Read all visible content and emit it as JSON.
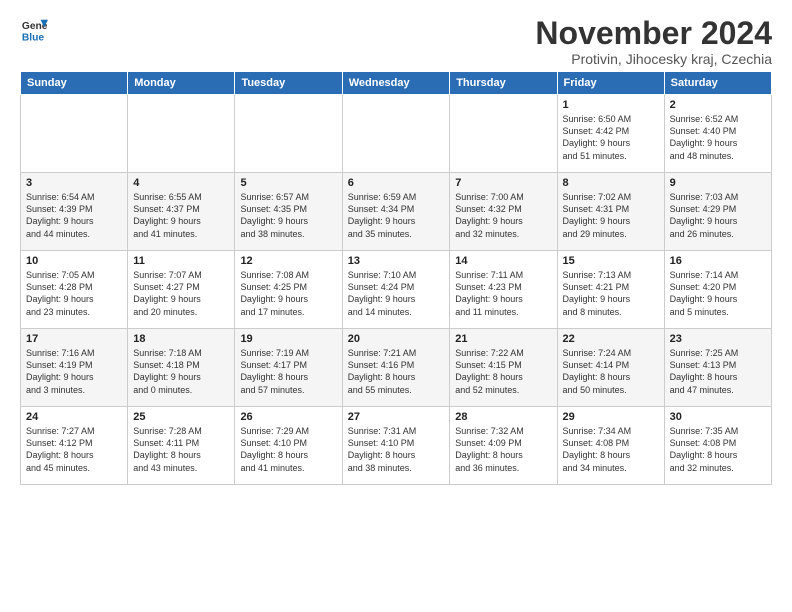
{
  "logo": {
    "general": "General",
    "blue": "Blue"
  },
  "title": "November 2024",
  "subtitle": "Protivin, Jihocesky kraj, Czechia",
  "days_of_week": [
    "Sunday",
    "Monday",
    "Tuesday",
    "Wednesday",
    "Thursday",
    "Friday",
    "Saturday"
  ],
  "weeks": [
    [
      {
        "day": "",
        "info": ""
      },
      {
        "day": "",
        "info": ""
      },
      {
        "day": "",
        "info": ""
      },
      {
        "day": "",
        "info": ""
      },
      {
        "day": "",
        "info": ""
      },
      {
        "day": "1",
        "info": "Sunrise: 6:50 AM\nSunset: 4:42 PM\nDaylight: 9 hours\nand 51 minutes."
      },
      {
        "day": "2",
        "info": "Sunrise: 6:52 AM\nSunset: 4:40 PM\nDaylight: 9 hours\nand 48 minutes."
      }
    ],
    [
      {
        "day": "3",
        "info": "Sunrise: 6:54 AM\nSunset: 4:39 PM\nDaylight: 9 hours\nand 44 minutes."
      },
      {
        "day": "4",
        "info": "Sunrise: 6:55 AM\nSunset: 4:37 PM\nDaylight: 9 hours\nand 41 minutes."
      },
      {
        "day": "5",
        "info": "Sunrise: 6:57 AM\nSunset: 4:35 PM\nDaylight: 9 hours\nand 38 minutes."
      },
      {
        "day": "6",
        "info": "Sunrise: 6:59 AM\nSunset: 4:34 PM\nDaylight: 9 hours\nand 35 minutes."
      },
      {
        "day": "7",
        "info": "Sunrise: 7:00 AM\nSunset: 4:32 PM\nDaylight: 9 hours\nand 32 minutes."
      },
      {
        "day": "8",
        "info": "Sunrise: 7:02 AM\nSunset: 4:31 PM\nDaylight: 9 hours\nand 29 minutes."
      },
      {
        "day": "9",
        "info": "Sunrise: 7:03 AM\nSunset: 4:29 PM\nDaylight: 9 hours\nand 26 minutes."
      }
    ],
    [
      {
        "day": "10",
        "info": "Sunrise: 7:05 AM\nSunset: 4:28 PM\nDaylight: 9 hours\nand 23 minutes."
      },
      {
        "day": "11",
        "info": "Sunrise: 7:07 AM\nSunset: 4:27 PM\nDaylight: 9 hours\nand 20 minutes."
      },
      {
        "day": "12",
        "info": "Sunrise: 7:08 AM\nSunset: 4:25 PM\nDaylight: 9 hours\nand 17 minutes."
      },
      {
        "day": "13",
        "info": "Sunrise: 7:10 AM\nSunset: 4:24 PM\nDaylight: 9 hours\nand 14 minutes."
      },
      {
        "day": "14",
        "info": "Sunrise: 7:11 AM\nSunset: 4:23 PM\nDaylight: 9 hours\nand 11 minutes."
      },
      {
        "day": "15",
        "info": "Sunrise: 7:13 AM\nSunset: 4:21 PM\nDaylight: 9 hours\nand 8 minutes."
      },
      {
        "day": "16",
        "info": "Sunrise: 7:14 AM\nSunset: 4:20 PM\nDaylight: 9 hours\nand 5 minutes."
      }
    ],
    [
      {
        "day": "17",
        "info": "Sunrise: 7:16 AM\nSunset: 4:19 PM\nDaylight: 9 hours\nand 3 minutes."
      },
      {
        "day": "18",
        "info": "Sunrise: 7:18 AM\nSunset: 4:18 PM\nDaylight: 9 hours\nand 0 minutes."
      },
      {
        "day": "19",
        "info": "Sunrise: 7:19 AM\nSunset: 4:17 PM\nDaylight: 8 hours\nand 57 minutes."
      },
      {
        "day": "20",
        "info": "Sunrise: 7:21 AM\nSunset: 4:16 PM\nDaylight: 8 hours\nand 55 minutes."
      },
      {
        "day": "21",
        "info": "Sunrise: 7:22 AM\nSunset: 4:15 PM\nDaylight: 8 hours\nand 52 minutes."
      },
      {
        "day": "22",
        "info": "Sunrise: 7:24 AM\nSunset: 4:14 PM\nDaylight: 8 hours\nand 50 minutes."
      },
      {
        "day": "23",
        "info": "Sunrise: 7:25 AM\nSunset: 4:13 PM\nDaylight: 8 hours\nand 47 minutes."
      }
    ],
    [
      {
        "day": "24",
        "info": "Sunrise: 7:27 AM\nSunset: 4:12 PM\nDaylight: 8 hours\nand 45 minutes."
      },
      {
        "day": "25",
        "info": "Sunrise: 7:28 AM\nSunset: 4:11 PM\nDaylight: 8 hours\nand 43 minutes."
      },
      {
        "day": "26",
        "info": "Sunrise: 7:29 AM\nSunset: 4:10 PM\nDaylight: 8 hours\nand 41 minutes."
      },
      {
        "day": "27",
        "info": "Sunrise: 7:31 AM\nSunset: 4:10 PM\nDaylight: 8 hours\nand 38 minutes."
      },
      {
        "day": "28",
        "info": "Sunrise: 7:32 AM\nSunset: 4:09 PM\nDaylight: 8 hours\nand 36 minutes."
      },
      {
        "day": "29",
        "info": "Sunrise: 7:34 AM\nSunset: 4:08 PM\nDaylight: 8 hours\nand 34 minutes."
      },
      {
        "day": "30",
        "info": "Sunrise: 7:35 AM\nSunset: 4:08 PM\nDaylight: 8 hours\nand 32 minutes."
      }
    ]
  ]
}
